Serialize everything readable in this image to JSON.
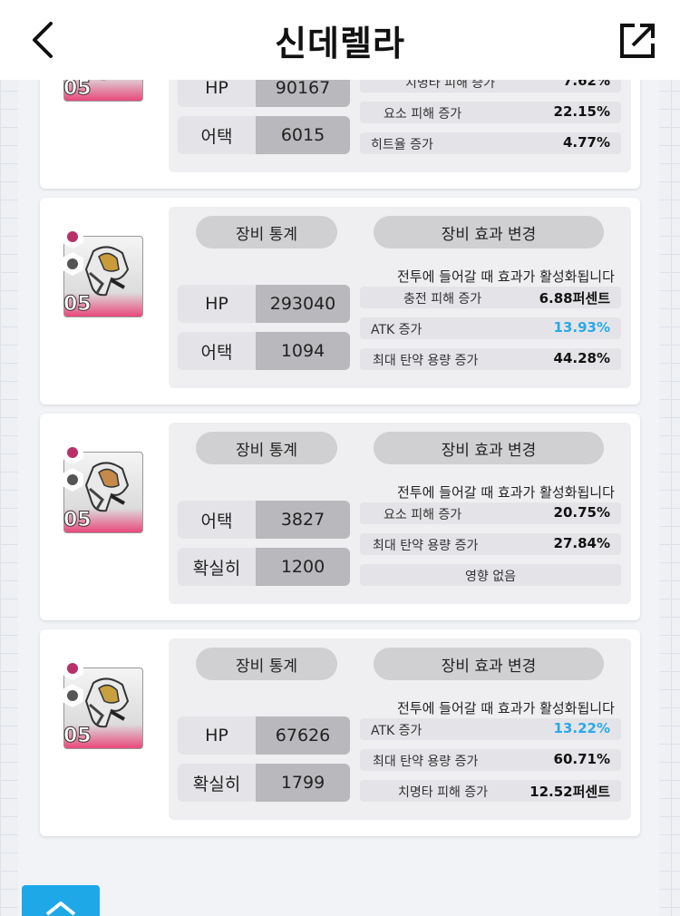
{
  "header": {
    "title": "신데렐라"
  },
  "labels": {
    "stats_tab": "장비 통계",
    "effect_tab": "장비 효과 변경",
    "note": "전투에 들어갈 때 효과가 활성화됩니다"
  },
  "items": [
    {
      "level": "05",
      "stats": [
        {
          "label": "HP",
          "value": "90167"
        },
        {
          "label": "어택",
          "value": "6015"
        }
      ],
      "effects": [
        {
          "name": "치명타 피해 증가",
          "value": "7.62%"
        },
        {
          "name": "요소 피해 증가",
          "value": "22.15%"
        },
        {
          "name": "히트율 증가",
          "value": "4.77%"
        }
      ]
    },
    {
      "level": "05",
      "stats": [
        {
          "label": "HP",
          "value": "293040"
        },
        {
          "label": "어택",
          "value": "1094"
        }
      ],
      "effects": [
        {
          "name": "충전 피해 증가",
          "value": "6.88퍼센트"
        },
        {
          "name": "ATK 증가",
          "value": "13.93%"
        },
        {
          "name": "최대 탄약 용량 증가",
          "value": "44.28%"
        }
      ]
    },
    {
      "level": "05",
      "stats": [
        {
          "label": "어택",
          "value": "3827"
        },
        {
          "label": "확실히",
          "value": "1200"
        }
      ],
      "effects": [
        {
          "name": "요소 피해 증가",
          "value": "20.75%"
        },
        {
          "name": "최대 탄약 용량 증가",
          "value": "27.84%"
        },
        {
          "name": "영향 없음",
          "value": ""
        }
      ]
    },
    {
      "level": "05",
      "stats": [
        {
          "label": "HP",
          "value": "67626"
        },
        {
          "label": "확실히",
          "value": "1799"
        }
      ],
      "effects": [
        {
          "name": "ATK 증가",
          "value": "13.22%"
        },
        {
          "name": "최대 탄약 용량 증가",
          "value": "60.71%"
        },
        {
          "name": "치명타 피해 증가",
          "value": "12.52퍼센트"
        }
      ]
    }
  ],
  "colors": {
    "accent_blue": "#29a9e8",
    "badge_pink": "#e8497c",
    "scroll_button": "#1fa8e8"
  },
  "icons": {
    "back": "chevron-left-icon",
    "share": "share-external-icon",
    "scroll_top": "chevron-up-icon"
  }
}
